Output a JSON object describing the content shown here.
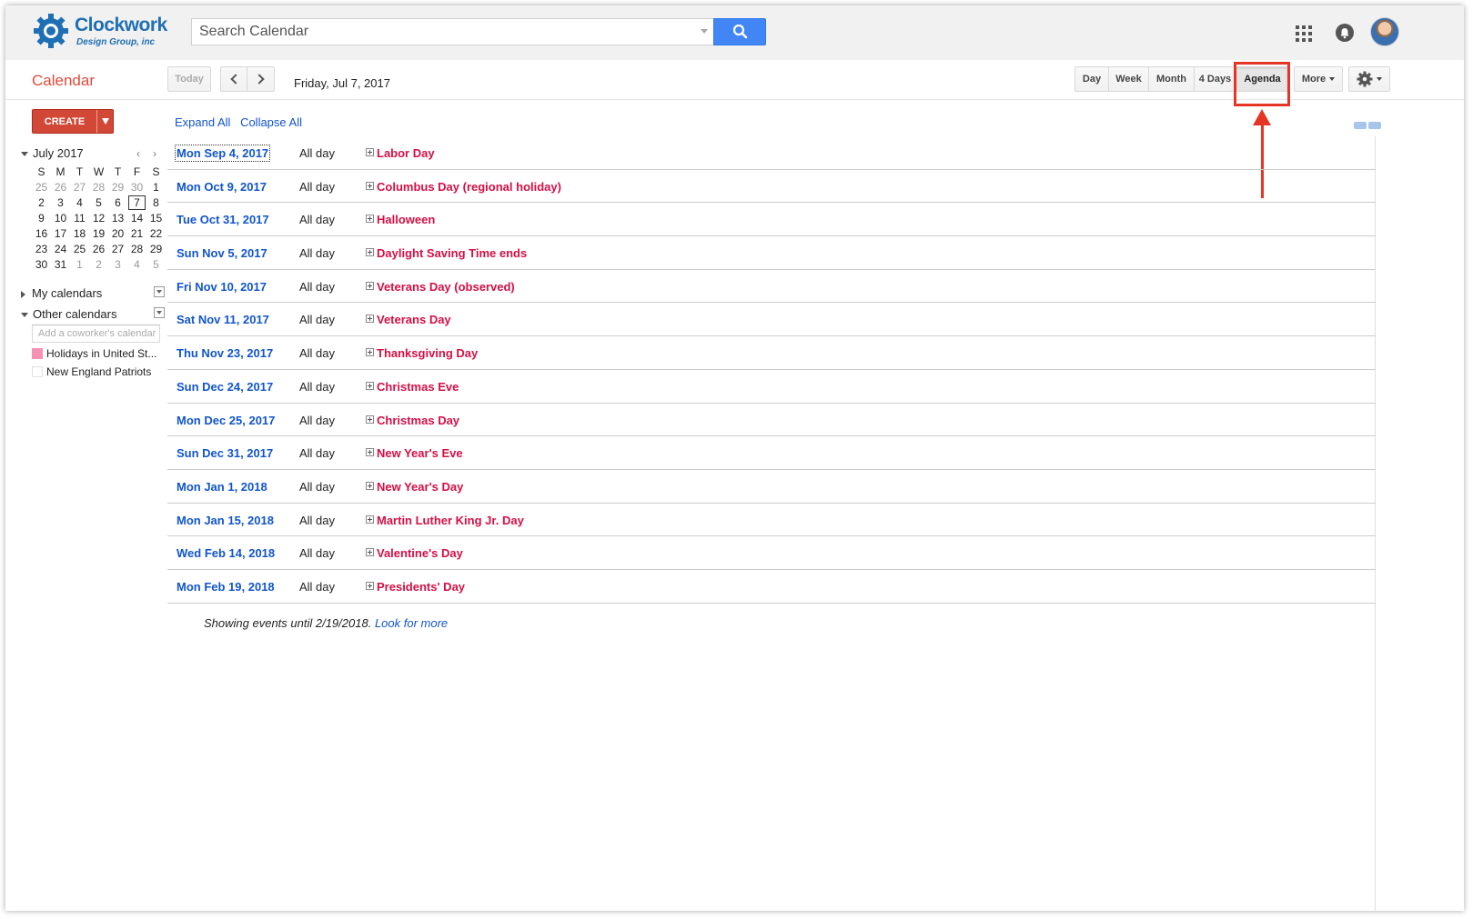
{
  "brand": {
    "line1": "Clockwork",
    "line2": "Design Group, inc"
  },
  "search": {
    "placeholder": "Search Calendar"
  },
  "toolbar": {
    "title": "Calendar",
    "today": "Today",
    "current_date": "Friday, Jul 7, 2017",
    "views": [
      "Day",
      "Week",
      "Month",
      "4 Days",
      "Agenda"
    ],
    "active_view": "Agenda",
    "more": "More"
  },
  "sidebar": {
    "create": "CREATE",
    "mini_cal": {
      "month": "July 2017",
      "weekdays": [
        "S",
        "M",
        "T",
        "W",
        "T",
        "F",
        "S"
      ],
      "weeks": [
        [
          "25",
          "26",
          "27",
          "28",
          "29",
          "30",
          "1"
        ],
        [
          "2",
          "3",
          "4",
          "5",
          "6",
          "7",
          "8"
        ],
        [
          "9",
          "10",
          "11",
          "12",
          "13",
          "14",
          "15"
        ],
        [
          "16",
          "17",
          "18",
          "19",
          "20",
          "21",
          "22"
        ],
        [
          "23",
          "24",
          "25",
          "26",
          "27",
          "28",
          "29"
        ],
        [
          "30",
          "31",
          "1",
          "2",
          "3",
          "4",
          "5"
        ]
      ],
      "today": "7"
    },
    "my_calendars": "My calendars",
    "other_calendars": "Other calendars",
    "add_placeholder": "Add a coworker's calendar",
    "calendars": [
      {
        "name": "Holidays in United St...",
        "color": "#f691b2",
        "checked": true
      },
      {
        "name": "New England Patriots",
        "color": "#ffffff",
        "checked": false
      }
    ]
  },
  "main": {
    "expand_all": "Expand All",
    "collapse_all": "Collapse All",
    "events": [
      {
        "date": "Mon Sep 4, 2017",
        "time": "All day",
        "title": "Labor Day"
      },
      {
        "date": "Mon Oct 9, 2017",
        "time": "All day",
        "title": "Columbus Day (regional holiday)"
      },
      {
        "date": "Tue Oct 31, 2017",
        "time": "All day",
        "title": "Halloween"
      },
      {
        "date": "Sun Nov 5, 2017",
        "time": "All day",
        "title": "Daylight Saving Time ends"
      },
      {
        "date": "Fri Nov 10, 2017",
        "time": "All day",
        "title": "Veterans Day (observed)"
      },
      {
        "date": "Sat Nov 11, 2017",
        "time": "All day",
        "title": "Veterans Day"
      },
      {
        "date": "Thu Nov 23, 2017",
        "time": "All day",
        "title": "Thanksgiving Day"
      },
      {
        "date": "Sun Dec 24, 2017",
        "time": "All day",
        "title": "Christmas Eve"
      },
      {
        "date": "Mon Dec 25, 2017",
        "time": "All day",
        "title": "Christmas Day"
      },
      {
        "date": "Sun Dec 31, 2017",
        "time": "All day",
        "title": "New Year's Eve"
      },
      {
        "date": "Mon Jan 1, 2018",
        "time": "All day",
        "title": "New Year's Day"
      },
      {
        "date": "Mon Jan 15, 2018",
        "time": "All day",
        "title": "Martin Luther King Jr. Day"
      },
      {
        "date": "Wed Feb 14, 2018",
        "time": "All day",
        "title": "Valentine's Day"
      },
      {
        "date": "Mon Feb 19, 2018",
        "time": "All day",
        "title": "Presidents' Day"
      }
    ],
    "footer_text": "Showing events until 2/19/2018.",
    "footer_link": "Look for more"
  },
  "colors": {
    "accent_red": "#dd4b39",
    "link_blue": "#1155cc",
    "event_red": "#d50f45",
    "search_blue": "#4285f4"
  }
}
